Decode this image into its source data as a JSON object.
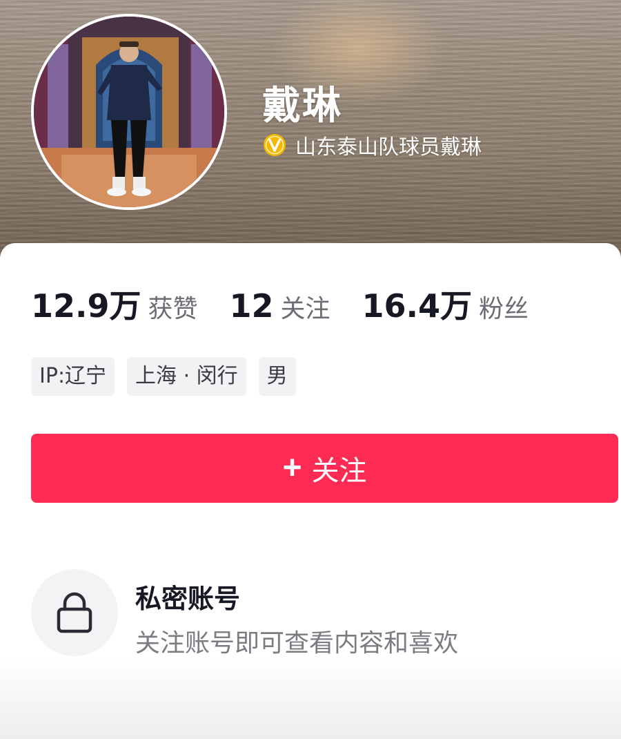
{
  "profile": {
    "name": "戴琳",
    "verification": "山东泰山队球员戴琳"
  },
  "stats": {
    "likes": {
      "value": "12.9万",
      "label": "获赞"
    },
    "following": {
      "value": "12",
      "label": "关注"
    },
    "followers": {
      "value": "16.4万",
      "label": "粉丝"
    }
  },
  "tags": [
    "IP:辽宁",
    "上海 · 闵行",
    "男"
  ],
  "follow_button": {
    "icon": "+",
    "label": "关注"
  },
  "private": {
    "title": "私密账号",
    "description": "关注账号即可查看内容和喜欢"
  },
  "colors": {
    "accent": "#fe2c55",
    "verify_badge": "#f5b800"
  },
  "icons": {
    "verify": "verified-v-icon",
    "lock": "lock-icon",
    "plus": "plus-icon"
  }
}
